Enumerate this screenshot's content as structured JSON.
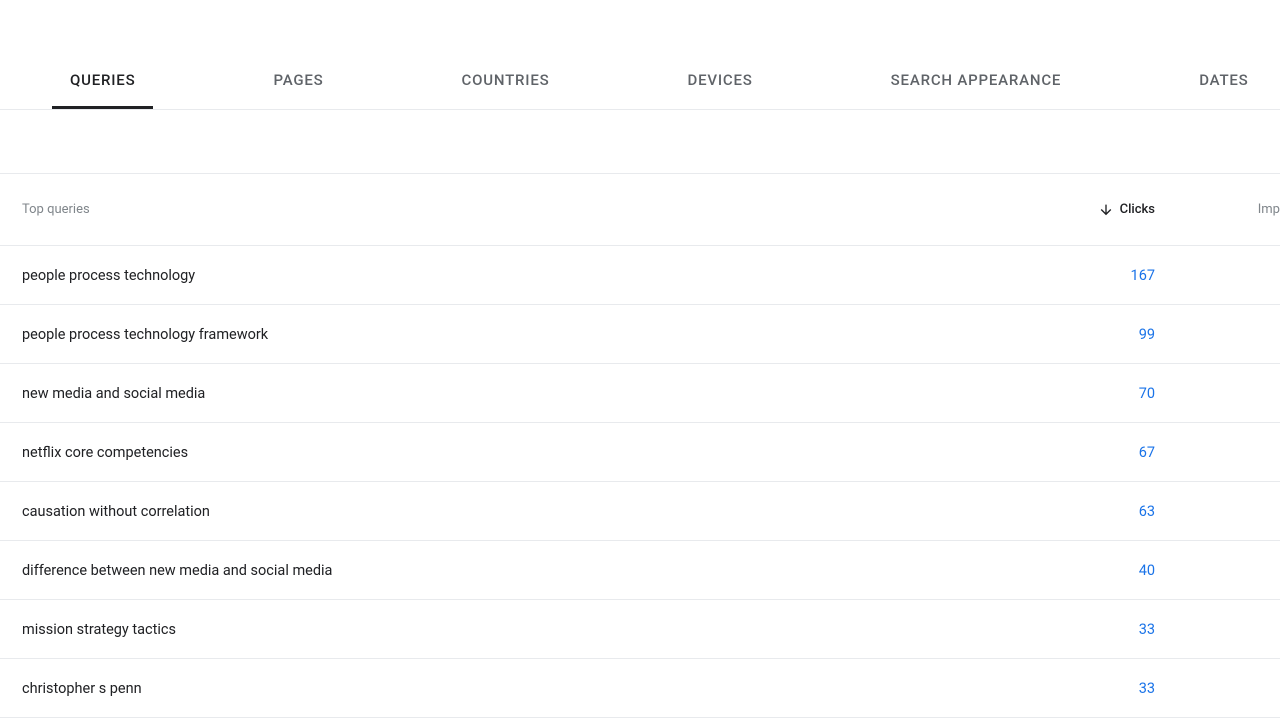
{
  "tabs": [
    {
      "label": "QUERIES",
      "active": true
    },
    {
      "label": "PAGES",
      "active": false
    },
    {
      "label": "COUNTRIES",
      "active": false
    },
    {
      "label": "DEVICES",
      "active": false
    },
    {
      "label": "SEARCH APPEARANCE",
      "active": false
    },
    {
      "label": "DATES",
      "active": false
    }
  ],
  "table": {
    "header": {
      "queries_label": "Top queries",
      "clicks_label": "Clicks",
      "impressions_label": "Imp"
    },
    "rows": [
      {
        "query": "people process technology",
        "clicks": "167"
      },
      {
        "query": "people process technology framework",
        "clicks": "99"
      },
      {
        "query": "new media and social media",
        "clicks": "70"
      },
      {
        "query": "netflix core competencies",
        "clicks": "67"
      },
      {
        "query": "causation without correlation",
        "clicks": "63"
      },
      {
        "query": "difference between new media and social media",
        "clicks": "40"
      },
      {
        "query": "mission strategy tactics",
        "clicks": "33"
      },
      {
        "query": "christopher s penn",
        "clicks": "33"
      }
    ]
  }
}
